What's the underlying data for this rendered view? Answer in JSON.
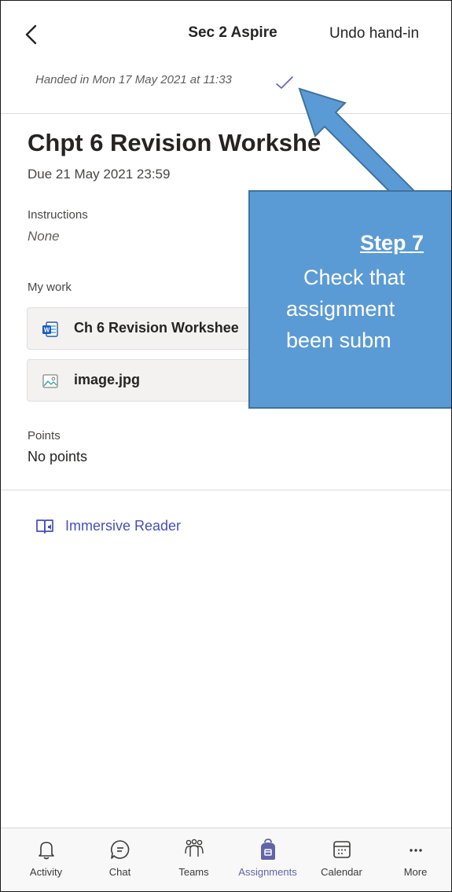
{
  "header": {
    "title": "Sec 2 Aspire",
    "action": "Undo hand-in"
  },
  "status": {
    "handed_in": "Handed in Mon 17 May 2021 at 11:33"
  },
  "assignment": {
    "title": "Chpt 6 Revision Workshe",
    "due": "Due 21 May 2021 23:59",
    "instructions_label": "Instructions",
    "instructions_value": "None",
    "my_work_label": "My work",
    "files": [
      {
        "name": "Ch 6 Revision Workshee",
        "icon": "word-doc-icon"
      },
      {
        "name": "image.jpg",
        "icon": "image-file-icon"
      }
    ],
    "points_label": "Points",
    "points_value": "No points",
    "immersive_reader": "Immersive Reader"
  },
  "callout": {
    "step": "Step 7",
    "lines": [
      "Check that",
      "assignment",
      "been subm"
    ]
  },
  "tabbar": {
    "active": "Assignments",
    "accent": "#6264a7",
    "items": [
      {
        "label": "Activity",
        "icon": "bell-icon"
      },
      {
        "label": "Chat",
        "icon": "chat-icon"
      },
      {
        "label": "Teams",
        "icon": "teams-icon"
      },
      {
        "label": "Assignments",
        "icon": "backpack-icon"
      },
      {
        "label": "Calendar",
        "icon": "calendar-icon"
      },
      {
        "label": "More",
        "icon": "more-icon"
      }
    ]
  }
}
